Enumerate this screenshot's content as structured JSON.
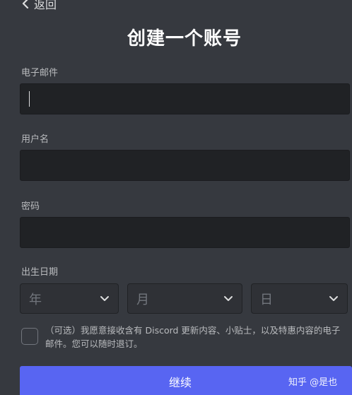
{
  "header": {
    "back_label": "返回",
    "title": "创建一个账号"
  },
  "form": {
    "email": {
      "label": "电子邮件",
      "value": ""
    },
    "username": {
      "label": "用户名",
      "value": ""
    },
    "password": {
      "label": "密码",
      "value": ""
    },
    "birthdate": {
      "label": "出生日期",
      "year_placeholder": "年",
      "month_placeholder": "月",
      "day_placeholder": "日"
    },
    "consent": {
      "checked": false,
      "text": "（可选）我愿意接收含有 Discord 更新内容、小贴士，以及特惠内容的电子邮件。您可以随时退订。"
    },
    "continue_label": "继续"
  },
  "watermark": "知乎 @是也",
  "colors": {
    "background": "#36393f",
    "input_background": "#202225",
    "select_background": "#2f3136",
    "accent": "#5865f2",
    "title": "#ffffff",
    "label": "#b9bbbe"
  }
}
